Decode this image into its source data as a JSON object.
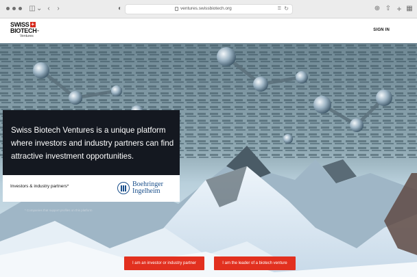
{
  "browser": {
    "url": "ventures.swissbiotech.org",
    "icons": [
      "sidebar-icon",
      "back-icon",
      "forward-icon",
      "privacy-shield-icon",
      "lock-icon",
      "translate-icon",
      "reload-icon",
      "download-icon",
      "share-icon",
      "new-tab-icon",
      "tab-overview-icon"
    ]
  },
  "header": {
    "logo_line1": "SWISS",
    "logo_line2": "BIOTECH",
    "logo_line2_suffix": "™",
    "logo_sub": "Ventures",
    "signin": "SIGN IN"
  },
  "hero": {
    "headline": "Swiss Biotech Ventures is a unique platform where investors and industry partners can find attractive investment opportunities.",
    "partners_label": "Investors & industry partners*",
    "partner_logo_line1": "Boehringer",
    "partner_logo_line2": "Ingelheim",
    "disclaimer": "* Companies that support profiles on this platform"
  },
  "cta": {
    "investor": "I am an investor or industry partner",
    "leader": "I am the leader of a biotech venture"
  },
  "colors": {
    "accent": "#e2301f",
    "panel": "#141820",
    "partner_blue": "#1a4f8b",
    "logo_red": "#d62b1e"
  }
}
